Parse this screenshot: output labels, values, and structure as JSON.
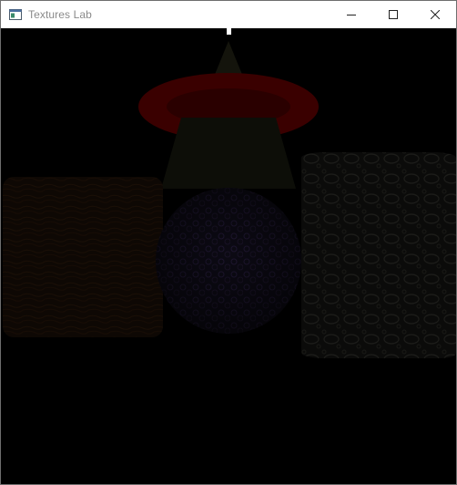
{
  "window": {
    "title": "Textures Lab",
    "controls": {
      "minimize": "minimize-icon",
      "maximize": "maximize-icon",
      "close": "close-icon"
    }
  },
  "scene": {
    "background": "#000000",
    "objects": [
      {
        "name": "cone",
        "color": "#14140c"
      },
      {
        "name": "torus",
        "color": "#3a0000"
      },
      {
        "name": "frustum",
        "color": "#0d0e08"
      },
      {
        "name": "cube",
        "color": "#0f0804"
      },
      {
        "name": "sphere",
        "color": "#0f0c1a"
      },
      {
        "name": "cylinder",
        "color": "#121210"
      }
    ]
  }
}
